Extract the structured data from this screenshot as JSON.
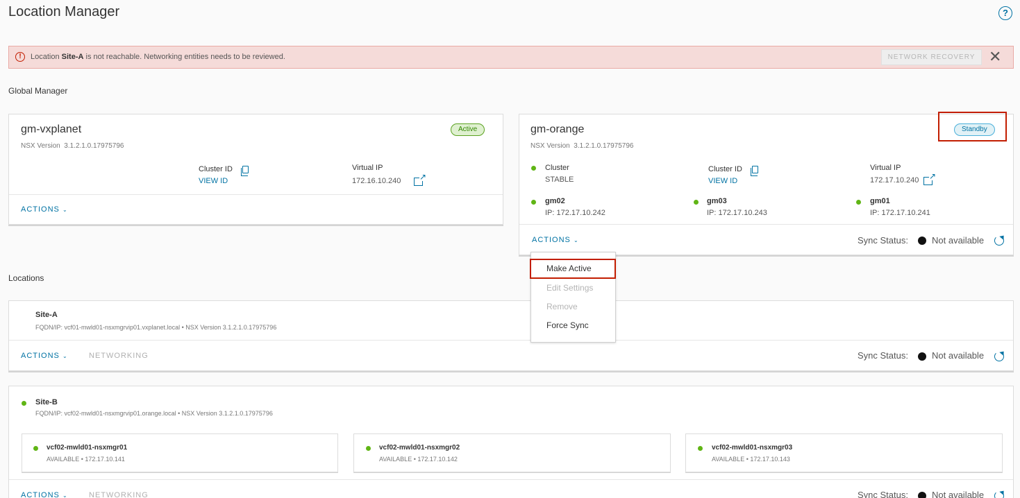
{
  "page": {
    "title": "Location Manager"
  },
  "alert": {
    "prefix": "Location ",
    "site": "Site-A",
    "suffix": " is not reachable. Networking entities needs to be reviewed.",
    "recovery_label": "NETWORK RECOVERY",
    "close_glyph": "✕"
  },
  "global_manager": {
    "section_label": "Global Manager",
    "active_card": {
      "name": "gm-vxplanet",
      "status": "Active",
      "version_label": "NSX Version",
      "version": "3.1.2.1.0.17975796",
      "cluster_id_label": "Cluster ID",
      "cluster_id_link": "VIEW ID",
      "vip_label": "Virtual IP",
      "vip": "172.16.10.240",
      "actions": "ACTIONS"
    },
    "standby_card": {
      "name": "gm-orange",
      "status": "Standby",
      "version_label": "NSX Version",
      "version": "3.1.2.1.0.17975796",
      "cluster_label": "Cluster",
      "cluster_status": "STABLE",
      "cluster_id_label": "Cluster ID",
      "cluster_id_link": "VIEW ID",
      "vip_label": "Virtual IP",
      "vip": "172.17.10.240",
      "nodes": [
        {
          "name": "gm02",
          "ip": "IP: 172.17.10.242"
        },
        {
          "name": "gm03",
          "ip": "IP: 172.17.10.243"
        },
        {
          "name": "gm01",
          "ip": "IP: 172.17.10.241"
        }
      ],
      "actions": "ACTIONS",
      "sync_label": "Sync Status:",
      "sync_value": "Not available"
    }
  },
  "actions_menu": {
    "items": [
      {
        "label": "Make Active",
        "enabled": true
      },
      {
        "label": "Edit Settings",
        "enabled": false
      },
      {
        "label": "Remove",
        "enabled": false
      },
      {
        "label": "Force Sync",
        "enabled": true
      }
    ]
  },
  "locations": {
    "section_label": "Locations",
    "sites": [
      {
        "name": "Site-A",
        "details": "FQDN/IP: vcf01-mwld01-nsxmgrvip01.vxplanet.local • NSX Version 3.1.2.1.0.17975796",
        "actions": "ACTIONS",
        "networking": "NETWORKING",
        "sync_label": "Sync Status:",
        "sync_value": "Not available"
      },
      {
        "name": "Site-B",
        "details": "FQDN/IP: vcf02-mwld01-nsxmgrvip01.orange.local • NSX Version 3.1.2.1.0.17975796",
        "managers": [
          {
            "name": "vcf02-mwld01-nsxmgr01",
            "status": "AVAILABLE • 172.17.10.141"
          },
          {
            "name": "vcf02-mwld01-nsxmgr02",
            "status": "AVAILABLE • 172.17.10.142"
          },
          {
            "name": "vcf02-mwld01-nsxmgr03",
            "status": "AVAILABLE • 172.17.10.143"
          }
        ],
        "actions": "ACTIONS",
        "networking": "NETWORKING",
        "sync_label": "Sync Status:",
        "sync_value": "Not available"
      }
    ]
  }
}
